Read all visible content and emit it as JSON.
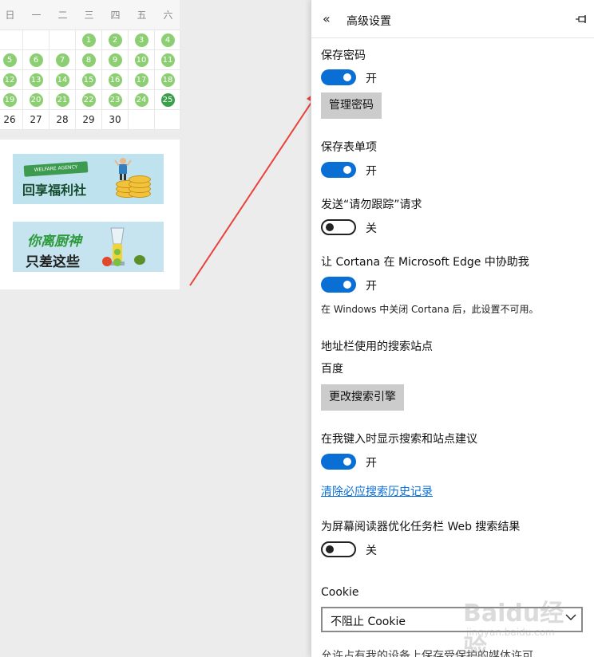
{
  "calendar": {
    "weekdays": [
      "日",
      "一",
      "二",
      "三",
      "四",
      "五",
      "六"
    ],
    "rows": [
      [
        "",
        "",
        "",
        "1",
        "2",
        "3",
        "4"
      ],
      [
        "5",
        "6",
        "7",
        "8",
        "9",
        "10",
        "11"
      ],
      [
        "12",
        "13",
        "14",
        "15",
        "16",
        "17",
        "18"
      ],
      [
        "19",
        "20",
        "21",
        "22",
        "23",
        "24",
        "25"
      ],
      [
        "26",
        "27",
        "28",
        "29",
        "30",
        "",
        ""
      ]
    ],
    "marked_through": 25,
    "today": "25",
    "colors": {
      "dot": "#8ccf72",
      "today": "#3aa04a"
    }
  },
  "ads": [
    {
      "name": "welfare",
      "ribbon": "WELFARE AGENCY",
      "title": "回享福利社"
    },
    {
      "name": "chef",
      "line1": "你离厨神",
      "line2": "只差这些"
    }
  ],
  "panel": {
    "title": "高级设置",
    "back_icon": "double-chevron-left-icon",
    "pin_icon": "pin-icon",
    "save_password": {
      "label": "保存密码",
      "state": "开",
      "on": true,
      "button": "管理密码"
    },
    "save_forms": {
      "label": "保存表单项",
      "state": "开",
      "on": true
    },
    "do_not_track": {
      "label": "发送“请勿跟踪”请求",
      "state": "关",
      "on": false
    },
    "cortana": {
      "label": "让 Cortana 在 Microsoft Edge 中协助我",
      "state": "开",
      "on": true,
      "note": "在 Windows 中关闭 Cortana 后，此设置不可用。"
    },
    "search_engine": {
      "label": "地址栏使用的搜索站点",
      "value": "百度",
      "button": "更改搜索引擎"
    },
    "suggestions": {
      "label": "在我键入时显示搜索和站点建议",
      "state": "开",
      "on": true,
      "link": "清除必应搜索历史记录"
    },
    "screen_reader": {
      "label": "为屏幕阅读器优化任务栏 Web 搜索结果",
      "state": "关",
      "on": false
    },
    "cookie": {
      "label": "Cookie",
      "value": "不阻止 Cookie"
    },
    "cutoff_text": "允许占有我的设备上保存受保护的媒体许可"
  },
  "watermark": {
    "logo": "Baidu经验",
    "url": "jingyan.baidu.com"
  },
  "colors": {
    "accent": "#0a6fd5",
    "button_bg": "#cccccc",
    "arrow": "#e8433a"
  }
}
